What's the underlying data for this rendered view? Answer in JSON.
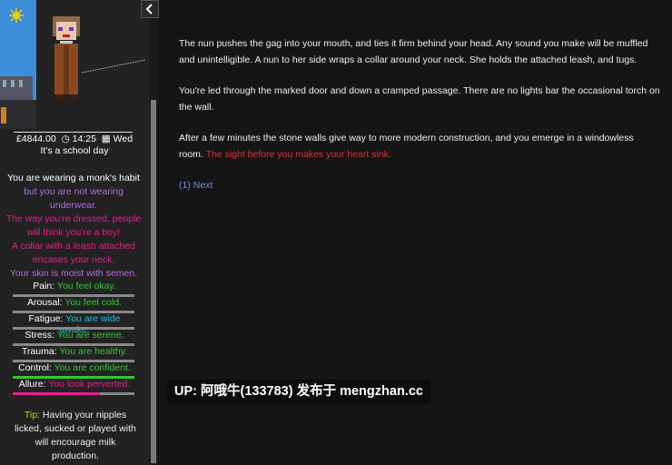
{
  "sidebar": {
    "money": "£4844.00",
    "time": "14:25",
    "day": "Wed",
    "school_day": "It's a school day",
    "appearance": {
      "a1": "You are wearing a monk's habit",
      "a2": "but you are not wearing underwear.",
      "a3": "The way you're dressed, people will think you're a boy!",
      "a4": "A collar with a leash attached encases your neck.",
      "a5": "Your skin is moist with semen."
    },
    "stats": [
      {
        "label": "Pain:",
        "value": "You feel okay.",
        "level": 0,
        "color": "#35c435"
      },
      {
        "label": "Arousal:",
        "value": "You feel cold.",
        "level": 0,
        "color": "#35c435"
      },
      {
        "label": "Fatigue:",
        "value": "You are wide awake.",
        "level": 0,
        "color": "#20c0d8"
      },
      {
        "label": "Stress:",
        "value": "You are serene.",
        "level": 0,
        "color": "#35c435"
      },
      {
        "label": "Trauma:",
        "value": "You are healthy.",
        "level": 0,
        "color": "#35c435"
      },
      {
        "label": "Control:",
        "value": "You are confident.",
        "level": 1.0,
        "color": "#35c435"
      },
      {
        "label": "Allure:",
        "value": "You look perverted.",
        "level": 0.72,
        "color": "#e6208a"
      }
    ],
    "tip_label": "Tip:",
    "tip_text": "Having your nipples licked, sucked or played with will encourage milk production."
  },
  "main": {
    "p1": "The nun pushes the gag into your mouth, and ties it firm behind your head. Any sound you make will be muffled and unintelligible. A nun to her side wraps a collar around your neck. She holds the attached leash, and tugs.",
    "p2": "You're led through the marked door and down a cramped passage. There are no lights bar the occasional torch on the wall.",
    "p3a": "After a few minutes the stone walls give way to more modern construction, and you emerge in a windowless room.",
    "p3b": "The sight before you makes your heart sink.",
    "next": "(1) Next"
  },
  "watermark": "UP: 阿哦牛(133783) 发布于 mengzhan.cc",
  "colors": {
    "alert_red": "#e03030",
    "link_blue": "#7090e0",
    "green": "#35c435",
    "pink": "#e6208a"
  }
}
